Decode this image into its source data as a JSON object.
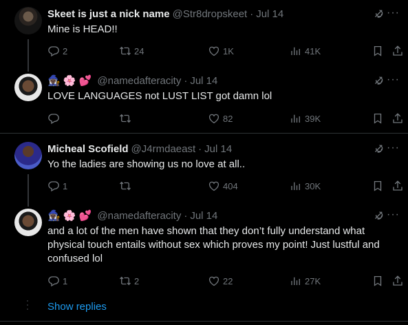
{
  "tweets": [
    {
      "name": "Skeet is just a nick name",
      "handle": "@Str8dropskeet",
      "time": "Jul 14",
      "text": "Mine is HEAD!!",
      "replies": "2",
      "retweets": "24",
      "likes": "1K",
      "views": "41K",
      "emojis": ""
    },
    {
      "name": "",
      "handle": "@namedafteracity",
      "time": "Jul 14",
      "text": "LOVE LANGUAGES not LUST LIST got damn lol",
      "replies": "",
      "retweets": "",
      "likes": "82",
      "views": "39K",
      "emojis": "🧙🏿‍♀️ 🌸 💕"
    },
    {
      "name": "Micheal Scofield",
      "handle": "@J4rmdaeast",
      "time": "Jul 14",
      "text": "Yo the ladies are showing us no love at all..",
      "replies": "1",
      "retweets": "",
      "likes": "404",
      "views": "30K",
      "emojis": ""
    },
    {
      "name": "",
      "handle": "@namedafteracity",
      "time": "Jul 14",
      "text": "and a lot of the men have shown that they don’t fully understand what physical touch entails without sex which proves my point! Just lustful and confused lol",
      "replies": "1",
      "retweets": "2",
      "likes": "22",
      "views": "27K",
      "emojis": "🧙🏿‍♀️ 🌸 💕"
    }
  ],
  "show_replies": "Show replies",
  "separator": "·",
  "colors": {
    "background": "#000000",
    "text": "#e7e9ea",
    "muted": "#71767b",
    "link": "#1d9bf0",
    "divider": "#2f3336"
  }
}
